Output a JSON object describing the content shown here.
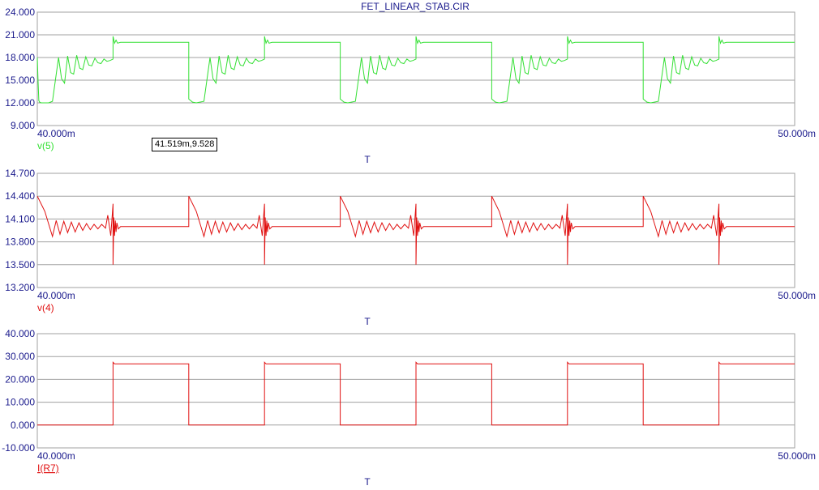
{
  "window": {
    "title": "FET_LINEAR_STAB.CIR"
  },
  "cursor_readout": "41.519m,9.528",
  "colors": {
    "axis_text": "#1a1a8c",
    "grid": "#a0a0a0",
    "green_trace": "#33e033",
    "red_trace": "#e01010"
  },
  "chart_data": [
    {
      "type": "line",
      "xlabel": "T",
      "xlim": [
        40.0,
        50.0
      ],
      "x_tick_labels": [
        "40.000m",
        "50.000m"
      ],
      "ylim": [
        9.0,
        24.0
      ],
      "y_tick_labels": [
        "24.000",
        "21.000",
        "18.000",
        "15.000",
        "12.000",
        "9.000"
      ],
      "series": [
        {
          "name": "v(5)",
          "color": "#33e033",
          "x": [
            40.0,
            40.01,
            40.02,
            40.03,
            40.05,
            40.1,
            40.15,
            40.2,
            40.28,
            40.32,
            40.36,
            40.4,
            40.44,
            40.48,
            40.52,
            40.56,
            40.6,
            40.64,
            40.68,
            40.72,
            40.76,
            40.8,
            40.84,
            40.88,
            40.92,
            40.96,
            41.0,
            41.0,
            41.02,
            41.04,
            41.06,
            41.1,
            42.0,
            42.0,
            42.05,
            42.1,
            42.2,
            42.28,
            42.32,
            42.36,
            42.4,
            42.44,
            42.48,
            42.52,
            42.56,
            42.6,
            42.64,
            42.68,
            42.72,
            42.76,
            42.8,
            42.84,
            42.88,
            42.92,
            42.96,
            43.0,
            43.0,
            43.02,
            43.04,
            43.06,
            43.1,
            44.0,
            44.0,
            44.05,
            44.1,
            44.2,
            44.28,
            44.32,
            44.36,
            44.4,
            44.44,
            44.48,
            44.52,
            44.56,
            44.6,
            44.64,
            44.68,
            44.72,
            44.76,
            44.8,
            44.84,
            44.88,
            44.92,
            44.96,
            45.0,
            45.0,
            45.02,
            45.04,
            45.06,
            45.1,
            46.0,
            46.0,
            46.05,
            46.1,
            46.2,
            46.28,
            46.32,
            46.36,
            46.4,
            46.44,
            46.48,
            46.52,
            46.56,
            46.6,
            46.64,
            46.68,
            46.72,
            46.76,
            46.8,
            46.84,
            46.88,
            46.92,
            46.96,
            47.0,
            47.0,
            47.02,
            47.04,
            47.06,
            47.1,
            48.0,
            48.0,
            48.05,
            48.1,
            48.2,
            48.28,
            48.32,
            48.36,
            48.4,
            48.44,
            48.48,
            48.52,
            48.56,
            48.6,
            48.64,
            48.68,
            48.72,
            48.76,
            48.8,
            48.84,
            48.88,
            48.92,
            48.96,
            49.0,
            49.0,
            49.02,
            49.04,
            49.06,
            49.1,
            50.0
          ],
          "y": [
            18.0,
            15.0,
            12.3,
            12.1,
            12.0,
            12.0,
            12.0,
            12.2,
            18.0,
            15.2,
            14.6,
            18.2,
            16.0,
            15.8,
            18.3,
            16.6,
            16.4,
            18.1,
            17.0,
            16.9,
            17.9,
            17.3,
            17.2,
            17.8,
            17.5,
            17.6,
            17.8,
            20.8,
            19.9,
            20.3,
            19.9,
            20.0,
            20.0,
            12.5,
            12.1,
            12.0,
            12.2,
            18.0,
            15.2,
            14.6,
            18.2,
            16.0,
            15.8,
            18.3,
            16.6,
            16.4,
            18.1,
            17.0,
            16.9,
            17.9,
            17.3,
            17.2,
            17.8,
            17.5,
            17.6,
            17.8,
            20.8,
            19.9,
            20.3,
            19.9,
            20.0,
            20.0,
            12.5,
            12.1,
            12.0,
            12.2,
            18.0,
            15.2,
            14.6,
            18.2,
            16.0,
            15.8,
            18.3,
            16.6,
            16.4,
            18.1,
            17.0,
            16.9,
            17.9,
            17.3,
            17.2,
            17.8,
            17.5,
            17.6,
            17.8,
            20.8,
            19.9,
            20.3,
            19.9,
            20.0,
            20.0,
            12.5,
            12.1,
            12.0,
            12.2,
            18.0,
            15.2,
            14.6,
            18.2,
            16.0,
            15.8,
            18.3,
            16.6,
            16.4,
            18.1,
            17.0,
            16.9,
            17.9,
            17.3,
            17.2,
            17.8,
            17.5,
            17.6,
            17.8,
            20.8,
            19.9,
            20.3,
            19.9,
            20.0,
            20.0,
            12.5,
            12.1,
            12.0,
            12.2,
            18.0,
            15.2,
            14.6,
            18.2,
            16.0,
            15.8,
            18.3,
            16.6,
            16.4,
            18.1,
            17.0,
            16.9,
            17.9,
            17.3,
            17.2,
            17.8,
            17.5,
            17.6,
            17.8,
            20.8,
            19.9,
            20.3,
            19.9,
            20.0,
            20.0
          ]
        }
      ]
    },
    {
      "type": "line",
      "xlabel": "T",
      "xlim": [
        40.0,
        50.0
      ],
      "x_tick_labels": [
        "40.000m",
        "50.000m"
      ],
      "ylim": [
        13.2,
        14.7
      ],
      "y_tick_labels": [
        "14.700",
        "14.400",
        "14.100",
        "13.800",
        "13.500",
        "13.200"
      ],
      "series": [
        {
          "name": "v(4)",
          "color": "#e01010",
          "x": [
            40.0,
            40.1,
            40.2,
            40.25,
            40.3,
            40.35,
            40.4,
            40.45,
            40.5,
            40.55,
            40.6,
            40.65,
            40.7,
            40.75,
            40.8,
            40.85,
            40.9,
            40.93,
            40.97,
            41.0,
            41.0,
            41.01,
            41.02,
            41.03,
            41.04,
            41.05,
            41.07,
            41.1,
            42.0,
            42.0,
            42.1,
            42.2,
            42.25,
            42.3,
            42.35,
            42.4,
            42.45,
            42.5,
            42.55,
            42.6,
            42.65,
            42.7,
            42.75,
            42.8,
            42.85,
            42.9,
            42.93,
            42.97,
            43.0,
            43.0,
            43.01,
            43.02,
            43.03,
            43.04,
            43.05,
            43.07,
            43.1,
            44.0,
            44.0,
            44.1,
            44.2,
            44.25,
            44.3,
            44.35,
            44.4,
            44.45,
            44.5,
            44.55,
            44.6,
            44.65,
            44.7,
            44.75,
            44.8,
            44.85,
            44.9,
            44.93,
            44.97,
            45.0,
            45.0,
            45.01,
            45.02,
            45.03,
            45.04,
            45.05,
            45.07,
            45.1,
            46.0,
            46.0,
            46.1,
            46.2,
            46.25,
            46.3,
            46.35,
            46.4,
            46.45,
            46.5,
            46.55,
            46.6,
            46.65,
            46.7,
            46.75,
            46.8,
            46.85,
            46.9,
            46.93,
            46.97,
            47.0,
            47.0,
            47.01,
            47.02,
            47.03,
            47.04,
            47.05,
            47.07,
            47.1,
            48.0,
            48.0,
            48.1,
            48.2,
            48.25,
            48.3,
            48.35,
            48.4,
            48.45,
            48.5,
            48.55,
            48.6,
            48.65,
            48.7,
            48.75,
            48.8,
            48.85,
            48.9,
            48.93,
            48.97,
            49.0,
            49.0,
            49.01,
            49.02,
            49.03,
            49.04,
            49.05,
            49.07,
            49.1,
            50.0
          ],
          "y": [
            14.4,
            14.2,
            13.87,
            14.08,
            13.9,
            14.07,
            13.92,
            14.06,
            13.93,
            14.05,
            13.95,
            14.04,
            13.96,
            14.03,
            13.97,
            14.03,
            13.98,
            14.15,
            13.88,
            14.3,
            13.5,
            14.12,
            13.88,
            14.08,
            13.93,
            14.05,
            13.97,
            14.0,
            14.0,
            14.4,
            14.2,
            13.87,
            14.08,
            13.9,
            14.07,
            13.92,
            14.06,
            13.93,
            14.05,
            13.95,
            14.04,
            13.96,
            14.03,
            13.97,
            14.03,
            13.98,
            14.15,
            13.88,
            14.3,
            13.5,
            14.12,
            13.88,
            14.08,
            13.93,
            14.05,
            13.97,
            14.0,
            14.0,
            14.4,
            14.2,
            13.87,
            14.08,
            13.9,
            14.07,
            13.92,
            14.06,
            13.93,
            14.05,
            13.95,
            14.04,
            13.96,
            14.03,
            13.97,
            14.03,
            13.98,
            14.15,
            13.88,
            14.3,
            13.5,
            14.12,
            13.88,
            14.08,
            13.93,
            14.05,
            13.97,
            14.0,
            14.0,
            14.4,
            14.2,
            13.87,
            14.08,
            13.9,
            14.07,
            13.92,
            14.06,
            13.93,
            14.05,
            13.95,
            14.04,
            13.96,
            14.03,
            13.97,
            14.03,
            13.98,
            14.15,
            13.88,
            14.3,
            13.5,
            14.12,
            13.88,
            14.08,
            13.93,
            14.05,
            13.97,
            14.0,
            14.0,
            14.4,
            14.2,
            13.87,
            14.08,
            13.9,
            14.07,
            13.92,
            14.06,
            13.93,
            14.05,
            13.95,
            14.04,
            13.96,
            14.03,
            13.97,
            14.03,
            13.98,
            14.15,
            13.88,
            14.3,
            13.5,
            14.12,
            13.88,
            14.08,
            13.93,
            14.05,
            13.97,
            14.0,
            14.0
          ]
        }
      ]
    },
    {
      "type": "line",
      "xlabel": "T",
      "xlim": [
        40.0,
        50.0
      ],
      "x_tick_labels": [
        "40.000m",
        "50.000m"
      ],
      "ylim": [
        -10.0,
        40.0
      ],
      "y_tick_labels": [
        "40.000",
        "30.000",
        "20.000",
        "10.000",
        "0.000",
        "-10.000"
      ],
      "series": [
        {
          "name": "I(R7)",
          "color": "#e01010",
          "x": [
            40.0,
            41.0,
            41.0,
            41.02,
            42.0,
            42.0,
            43.0,
            43.0,
            43.02,
            44.0,
            44.0,
            45.0,
            45.0,
            45.02,
            46.0,
            46.0,
            47.0,
            47.0,
            47.02,
            48.0,
            48.0,
            49.0,
            49.0,
            49.02,
            50.0
          ],
          "y": [
            0,
            0,
            27.5,
            26.8,
            26.8,
            0,
            0,
            27.5,
            26.8,
            26.8,
            0,
            0,
            27.5,
            26.8,
            26.8,
            0,
            0,
            27.5,
            26.8,
            26.8,
            0,
            0,
            27.5,
            26.8,
            26.8
          ]
        }
      ]
    }
  ]
}
